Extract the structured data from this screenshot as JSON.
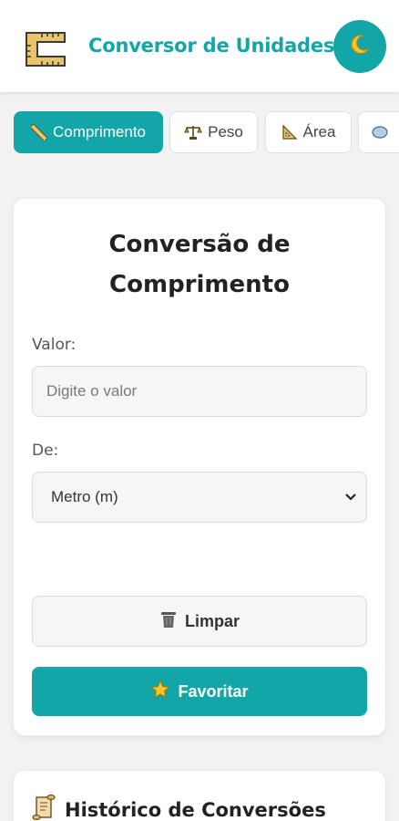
{
  "header": {
    "title": "Conversor de Unidades",
    "logo_icon": "ruler-logo-icon",
    "theme_toggle_icon": "moon-icon",
    "accent_color": "#13a6a8"
  },
  "tabs": [
    {
      "label": "Comprimento",
      "icon": "ruler-icon",
      "active": true
    },
    {
      "label": "Peso",
      "icon": "scale-icon",
      "active": false
    },
    {
      "label": "Área",
      "icon": "triangle-ruler-icon",
      "active": false
    },
    {
      "label": "",
      "icon": "cylinder-icon",
      "active": false
    }
  ],
  "converter": {
    "title": "Conversão de Comprimento",
    "value_label": "Valor:",
    "value_placeholder": "Digite o valor",
    "value": "",
    "from_label": "De:",
    "from_selected": "Metro (m)",
    "clear_label": "Limpar",
    "clear_icon": "trash-icon",
    "favorite_label": "Favoritar",
    "favorite_icon": "star-icon"
  },
  "history": {
    "title": "Histórico de Conversões",
    "icon": "scroll-icon"
  }
}
